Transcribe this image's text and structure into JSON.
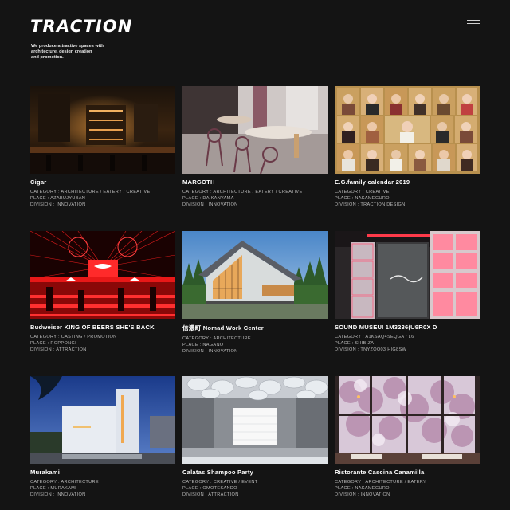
{
  "brand": {
    "logo": "TRACTION",
    "tagline": [
      "We produce attractive spaces with",
      "architecture, design creation",
      "and promotion."
    ]
  },
  "menu": {
    "icon": "hamburger-menu-icon"
  },
  "projects": [
    {
      "title": "Cigar",
      "category": "CATEGORY : ARCHITECTURE / EATERY / CREATIVE",
      "place": "PLACE : AZABUJYUBAN",
      "division": "DIVISION : INNOVATION"
    },
    {
      "title": "MARGOTH",
      "category": "CATEGORY : ARCHITECTURE / EATERY / CREATIVE",
      "place": "PLACE : DAIKANYAMA",
      "division": "DIVISION : INNOVATION"
    },
    {
      "title": "E.G.family calendar 2019",
      "category": "CATEGORY : CREATIVE",
      "place": "PLACE : NAKAMEGURO",
      "division": "DIVISION : TRACTION DESIGN"
    },
    {
      "title": "Budweiser KING OF BEERS SHE'S BACK",
      "category": "CATEGORY : CASTING / PROMOTION",
      "place": "PLACE : ROPPONGI",
      "division": "DIVISION : ATTRACTION"
    },
    {
      "title": "信濃町 Nomad Work Center",
      "category": "CATEGORY : ARCHITECTURE",
      "place": "PLACE : NAGANO",
      "division": "DIVISION : INNOVATION"
    },
    {
      "title": "SOUND MUSEUI 1M3236(U9R0X D",
      "category": "CATEGORY : A1KSAQ4SEQGA / L6",
      "place": "PLACE : SHIBIZA",
      "division": "DIVISION : TNYZQQ03 HIG8SW"
    },
    {
      "title": "Murakami",
      "category": "CATEGORY : ARCHITECTURE",
      "place": "PLACE : MURAKAMI",
      "division": "DIVISION : INNOVATION"
    },
    {
      "title": "Calatas Shampoo Party",
      "category": "CATEGORY : CREATIVE / EVENT",
      "place": "PLACE : OMOTESANDO",
      "division": "DIVISION : ATTRACTION"
    },
    {
      "title": "Ristorante Cascina Canamilla",
      "category": "CATEGORY : ARCHITECTURE / EATERY",
      "place": "PLACE : NAKAMEGURO",
      "division": "DIVISION : INNOVATION"
    }
  ]
}
